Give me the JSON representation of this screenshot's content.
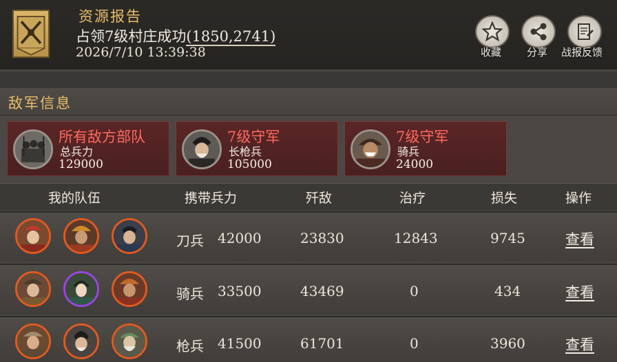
{
  "header": {
    "title": "资源报告",
    "subtitle_main": "占领7级村庄成功",
    "subtitle_coord": "(1850,2741)",
    "datetime": "2026/7/10 13:39:38",
    "buttons": [
      {
        "label": "收藏",
        "icon": "star-icon"
      },
      {
        "label": "分享",
        "icon": "share-icon"
      },
      {
        "label": "战报反馈",
        "icon": "feedback-scroll-icon"
      }
    ]
  },
  "enemy": {
    "section_title": "敌军信息",
    "cards": [
      {
        "name": "所有敌方部队",
        "type": "总兵力",
        "count": "129000"
      },
      {
        "name": "7级守军",
        "type": "长枪兵",
        "count": "105000"
      },
      {
        "name": "7级守军",
        "type": "骑兵",
        "count": "24000"
      }
    ]
  },
  "table": {
    "headers": [
      "我的队伍",
      "携带兵力",
      "歼敌",
      "治疗",
      "损失",
      "操作"
    ],
    "rows": [
      {
        "troop": "刀兵",
        "count": "42000",
        "kills": "23830",
        "heal": "12843",
        "loss": "9745",
        "action": "查看"
      },
      {
        "troop": "骑兵",
        "count": "33500",
        "kills": "43469",
        "heal": "0",
        "loss": "434",
        "action": "查看"
      },
      {
        "troop": "枪兵",
        "count": "41500",
        "kills": "61701",
        "heal": "0",
        "loss": "3960",
        "action": "查看"
      }
    ]
  },
  "colors": {
    "accent_gold": "#e8bc6a",
    "enemy_red": "#ff6a60",
    "hero_border_orange": "#e05a20",
    "hero_border_purple": "#9a44e0"
  }
}
